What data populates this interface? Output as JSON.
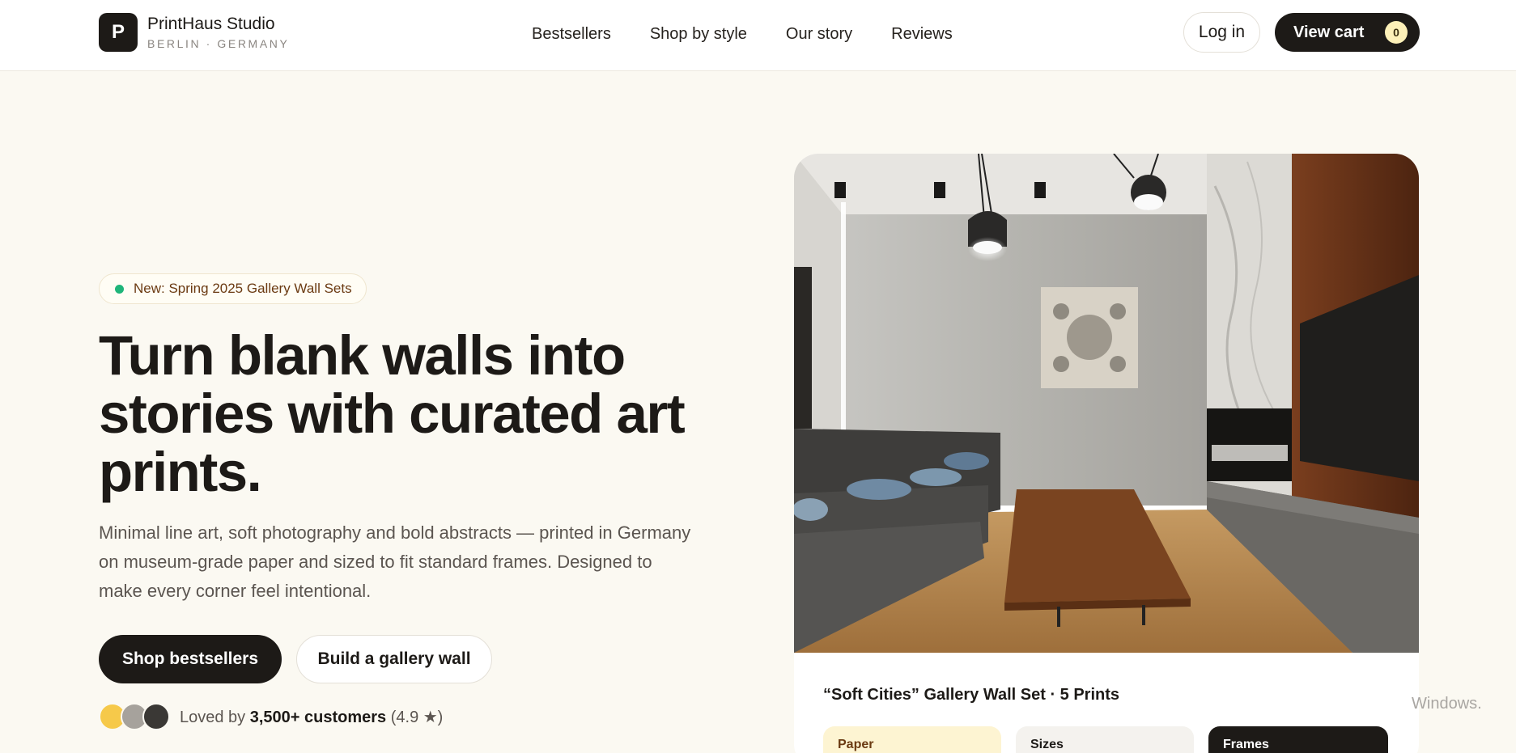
{
  "brand": {
    "logo_letter": "P",
    "name": "PrintHaus Studio",
    "location": "BERLIN · GERMANY"
  },
  "nav": {
    "items": [
      "Bestsellers",
      "Shop by style",
      "Our story",
      "Reviews"
    ]
  },
  "header_actions": {
    "login_label": "Log in",
    "cart_label": "View cart",
    "cart_count": "0"
  },
  "hero": {
    "badge": "New: Spring 2025 Gallery Wall Sets",
    "headline": "Turn blank walls into stories with curated art prints.",
    "subcopy": "Minimal line art, soft photography and bold abstracts — printed in Germany on museum-grade paper and sized to fit standard frames. Designed to make every corner feel intentional.",
    "primary_cta": "Shop bestsellers",
    "secondary_cta": "Build a gallery wall",
    "social_prefix": "Loved by",
    "social_count": "3,500+ customers",
    "social_rating": "(4.9 ★)"
  },
  "featured": {
    "title": "“Soft Cities” Gallery Wall Set · 5 Prints",
    "tags": [
      "Paper",
      "Sizes",
      "Frames"
    ]
  },
  "overlay": {
    "watermark": "Windows."
  },
  "colors": {
    "background": "#fbf9f2",
    "ink": "#1d1a17",
    "badge_dot": "#1fb57a",
    "cart_badge": "#fdf0b8",
    "paper_tag": "#fdf4d2"
  }
}
